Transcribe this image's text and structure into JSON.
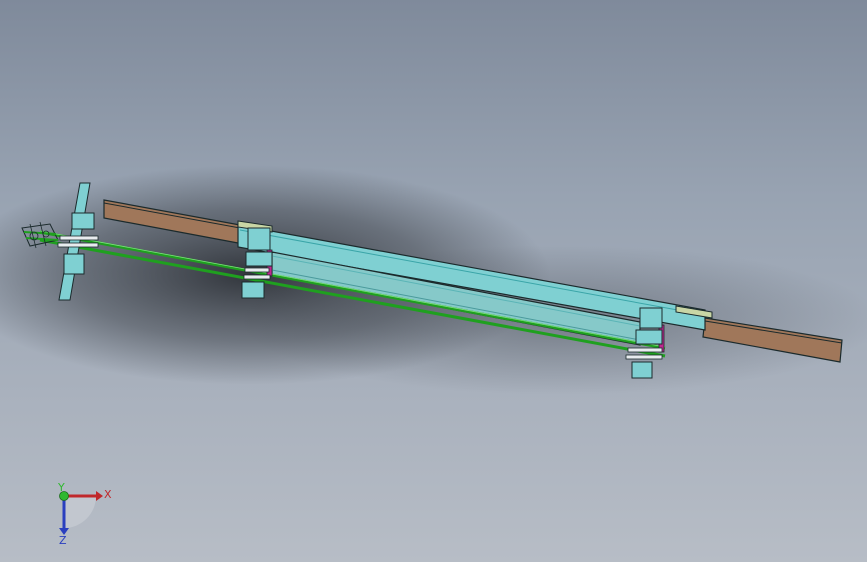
{
  "viewport": {
    "background_top": "#7f8a9b",
    "background_bottom": "#b7bdc6",
    "shadow_color": "#1e2126"
  },
  "assembly": {
    "colors": {
      "frame_cyan": "#7fd0d2",
      "frame_cyan_dark": "#3aa5a8",
      "tube_wood": "#a0775a",
      "rod_green": "#1fa01f",
      "plate_beige": "#c9d6a5",
      "bracket_magenta": "#c0268f",
      "edge_dark": "#1b2a2c"
    }
  },
  "triad": {
    "x_label": "X",
    "y_label": "Y",
    "z_label": "Z",
    "x_color": "#c0282b",
    "y_color": "#2fb82f",
    "z_color": "#2a3fbf"
  }
}
